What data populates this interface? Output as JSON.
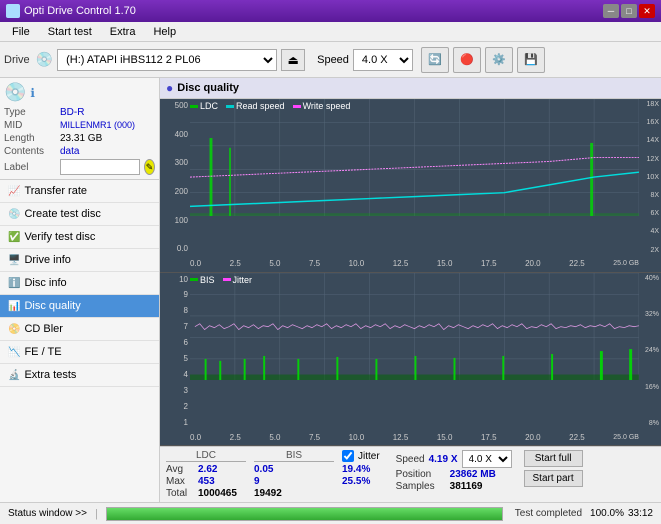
{
  "app": {
    "title": "Opti Drive Control 1.70",
    "icon": "disc"
  },
  "titlebar": {
    "minimize": "─",
    "maximize": "□",
    "close": "✕"
  },
  "menu": {
    "items": [
      "File",
      "Start test",
      "Extra",
      "Help"
    ]
  },
  "toolbar": {
    "drive_label": "Drive",
    "drive_value": "(H:)  ATAPI iHBS112  2 PL06",
    "speed_label": "Speed",
    "speed_value": "4.0 X"
  },
  "disc": {
    "type_label": "Type",
    "type_value": "BD-R",
    "mid_label": "MID",
    "mid_value": "MILLENMR1 (000)",
    "length_label": "Length",
    "length_value": "23.31 GB",
    "contents_label": "Contents",
    "contents_value": "data",
    "label_label": "Label"
  },
  "nav": {
    "items": [
      {
        "id": "transfer-rate",
        "label": "Transfer rate",
        "active": false
      },
      {
        "id": "create-test-disc",
        "label": "Create test disc",
        "active": false
      },
      {
        "id": "verify-test-disc",
        "label": "Verify test disc",
        "active": false
      },
      {
        "id": "drive-info",
        "label": "Drive info",
        "active": false
      },
      {
        "id": "disc-info",
        "label": "Disc info",
        "active": false
      },
      {
        "id": "disc-quality",
        "label": "Disc quality",
        "active": true
      },
      {
        "id": "cd-bler",
        "label": "CD Bler",
        "active": false
      },
      {
        "id": "fe-te",
        "label": "FE / TE",
        "active": false
      },
      {
        "id": "extra-tests",
        "label": "Extra tests",
        "active": false
      }
    ]
  },
  "content": {
    "title": "Disc quality"
  },
  "chart1": {
    "title": "LDC",
    "legend": [
      {
        "label": "LDC",
        "color": "#00aa00"
      },
      {
        "label": "Read speed",
        "color": "#00ffff"
      },
      {
        "label": "Write speed",
        "color": "#ff44ff"
      }
    ],
    "y_labels_left": [
      "500",
      "400",
      "300",
      "200",
      "100",
      "0.0"
    ],
    "y_labels_right": [
      "18X",
      "16X",
      "14X",
      "12X",
      "10X",
      "8X",
      "6X",
      "4X",
      "2X"
    ],
    "x_labels": [
      "0.0",
      "2.5",
      "5.0",
      "7.5",
      "10.0",
      "12.5",
      "15.0",
      "17.5",
      "20.0",
      "22.5",
      "25.0 GB"
    ]
  },
  "chart2": {
    "title": "BIS",
    "legend": [
      {
        "label": "BIS",
        "color": "#00aa00"
      },
      {
        "label": "Jitter",
        "color": "#ff44ff"
      }
    ],
    "y_labels_left": [
      "10",
      "9",
      "8",
      "7",
      "6",
      "5",
      "4",
      "3",
      "2",
      "1"
    ],
    "y_labels_right": [
      "40%",
      "32%",
      "24%",
      "16%",
      "8%"
    ],
    "x_labels": [
      "0.0",
      "2.5",
      "5.0",
      "7.5",
      "10.0",
      "12.5",
      "15.0",
      "17.5",
      "20.0",
      "22.5",
      "25.0 GB"
    ]
  },
  "stats": {
    "ldc_header": "LDC",
    "bis_header": "BIS",
    "jitter_header": "Jitter",
    "avg_label": "Avg",
    "max_label": "Max",
    "total_label": "Total",
    "ldc_avg": "2.62",
    "ldc_max": "453",
    "ldc_total": "1000465",
    "bis_avg": "0.05",
    "bis_max": "9",
    "bis_total": "19492",
    "jitter_avg": "19.4%",
    "jitter_max": "25.5%",
    "jitter_enabled": true,
    "speed_label": "Speed",
    "speed_val": "4.19 X",
    "speed_select": "4.0 X",
    "position_label": "Position",
    "position_val": "23862 MB",
    "samples_label": "Samples",
    "samples_val": "381169",
    "start_full_label": "Start full",
    "start_part_label": "Start part"
  },
  "statusbar": {
    "window_btn": "Status window >>",
    "progress": 100,
    "status_text": "Test completed",
    "time": "33:12"
  }
}
